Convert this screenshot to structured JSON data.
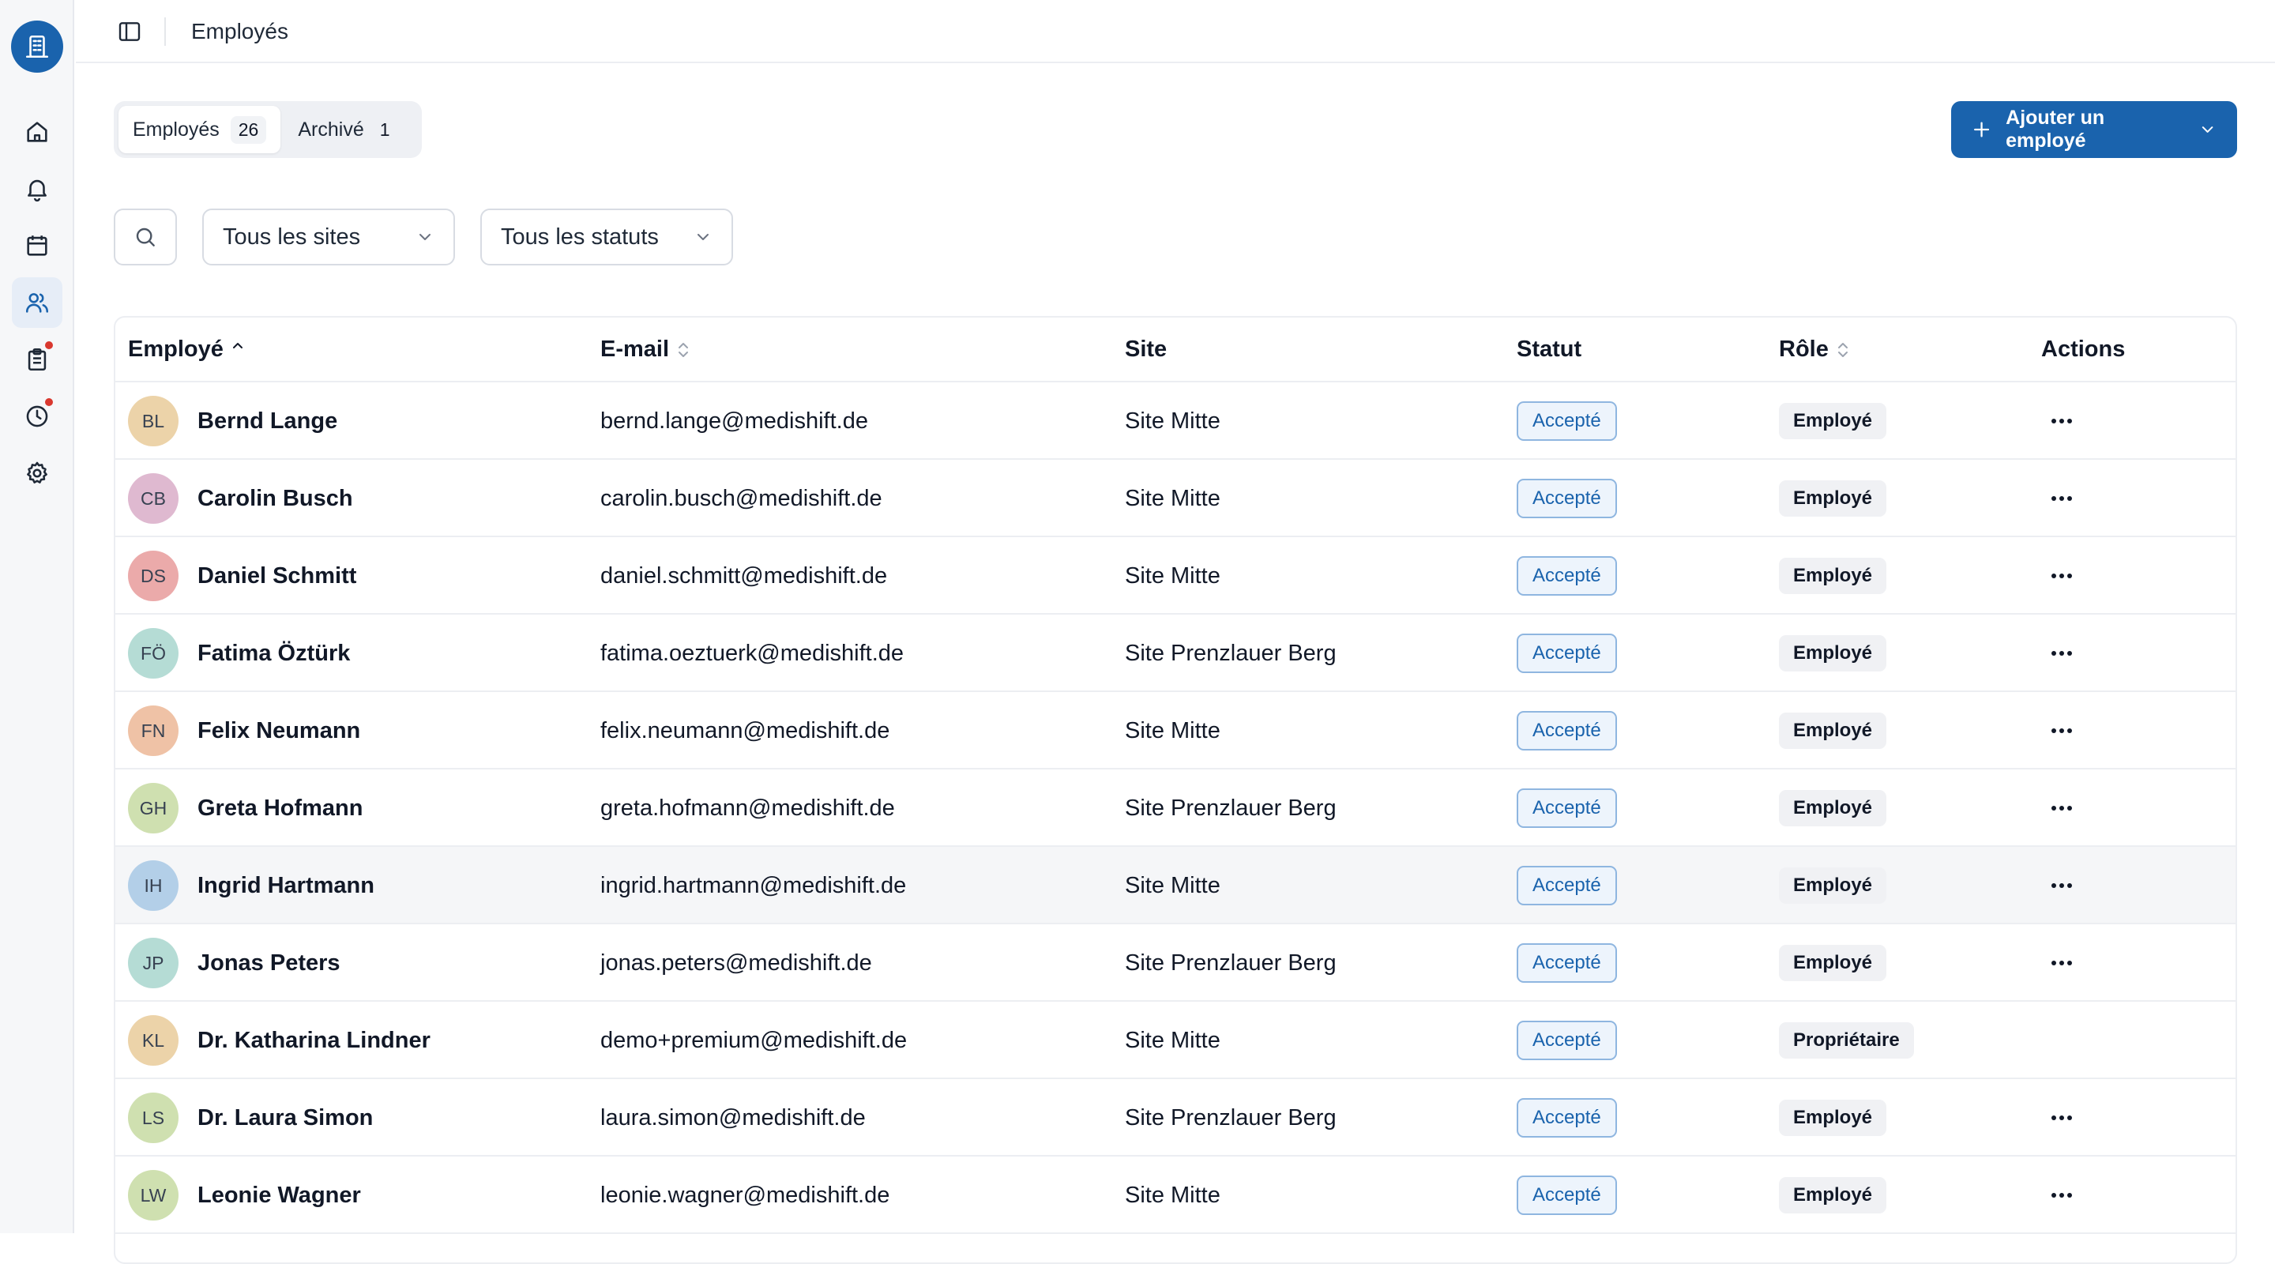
{
  "header": {
    "title": "Employés"
  },
  "tabs": [
    {
      "label": "Employés",
      "count": "26"
    },
    {
      "label": "Archivé",
      "count": "1"
    }
  ],
  "add_button": {
    "label": "Ajouter un employé"
  },
  "filters": {
    "sites": "Tous les sites",
    "statuses": "Tous les statuts"
  },
  "table": {
    "columns": {
      "employee": "Employé",
      "email": "E-mail",
      "site": "Site",
      "status": "Statut",
      "role": "Rôle",
      "actions": "Actions"
    },
    "rows": [
      {
        "initials": "BL",
        "name": "Bernd Lange",
        "email": "bernd.lange@medishift.de",
        "site": "Site Mitte",
        "status": "Accepté",
        "role": "Employé",
        "avatar_color": "#ecd3a9"
      },
      {
        "initials": "CB",
        "name": "Carolin Busch",
        "email": "carolin.busch@medishift.de",
        "site": "Site Mitte",
        "status": "Accepté",
        "role": "Employé",
        "avatar_color": "#dfb9d0"
      },
      {
        "initials": "DS",
        "name": "Daniel Schmitt",
        "email": "daniel.schmitt@medishift.de",
        "site": "Site Mitte",
        "status": "Accepté",
        "role": "Employé",
        "avatar_color": "#ebaaaa"
      },
      {
        "initials": "FÖ",
        "name": "Fatima Öztürk",
        "email": "fatima.oeztuerk@medishift.de",
        "site": "Site Prenzlauer Berg",
        "status": "Accepté",
        "role": "Employé",
        "avatar_color": "#b5dcd5"
      },
      {
        "initials": "FN",
        "name": "Felix Neumann",
        "email": "felix.neumann@medishift.de",
        "site": "Site Mitte",
        "status": "Accepté",
        "role": "Employé",
        "avatar_color": "#efc2a6"
      },
      {
        "initials": "GH",
        "name": "Greta Hofmann",
        "email": "greta.hofmann@medishift.de",
        "site": "Site Prenzlauer Berg",
        "status": "Accepté",
        "role": "Employé",
        "avatar_color": "#cfe0b0"
      },
      {
        "initials": "IH",
        "name": "Ingrid Hartmann",
        "email": "ingrid.hartmann@medishift.de",
        "site": "Site Mitte",
        "status": "Accepté",
        "role": "Employé",
        "avatar_color": "#b3cfe8"
      },
      {
        "initials": "JP",
        "name": "Jonas Peters",
        "email": "jonas.peters@medishift.de",
        "site": "Site Prenzlauer Berg",
        "status": "Accepté",
        "role": "Employé",
        "avatar_color": "#b5dcd5"
      },
      {
        "initials": "KL",
        "name": "Dr. Katharina Lindner",
        "email": "demo+premium@medishift.de",
        "site": "Site Mitte",
        "status": "Accepté",
        "role": "Propriétaire",
        "avatar_color": "#ecd3a9"
      },
      {
        "initials": "LS",
        "name": "Dr. Laura Simon",
        "email": "laura.simon@medishift.de",
        "site": "Site Prenzlauer Berg",
        "status": "Accepté",
        "role": "Employé",
        "avatar_color": "#cfe0b0"
      },
      {
        "initials": "LW",
        "name": "Leonie Wagner",
        "email": "leonie.wagner@medishift.de",
        "site": "Site Mitte",
        "status": "Accepté",
        "role": "Employé",
        "avatar_color": "#cfe0b0"
      }
    ]
  },
  "colors": {
    "brand": "#1a63ad",
    "notification_dot": "#d9382f"
  },
  "icons": [
    "building-icon",
    "home-icon",
    "bell-icon",
    "calendar-icon",
    "users-icon",
    "clipboard-icon",
    "clock-icon",
    "gear-icon"
  ]
}
